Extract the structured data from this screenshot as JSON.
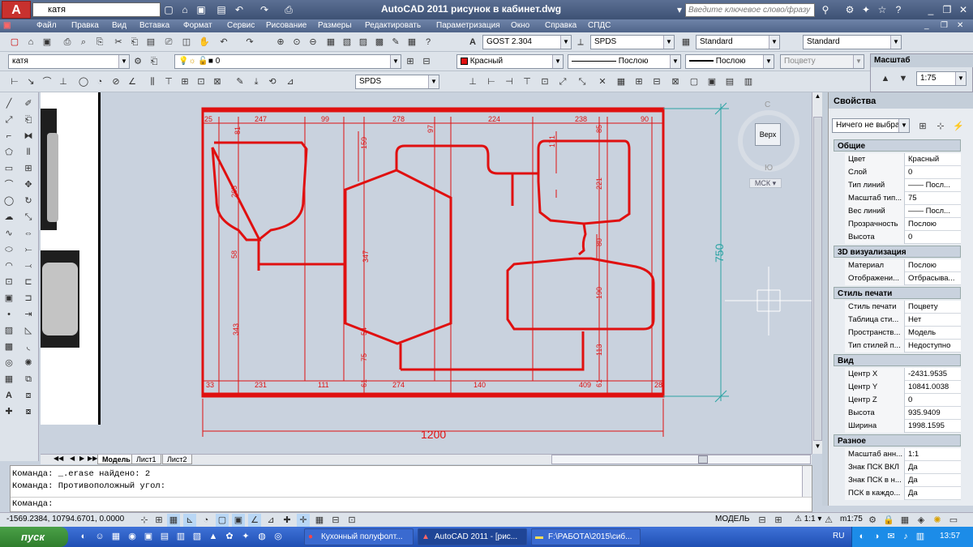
{
  "titlebar": {
    "logo": "A",
    "workspace": "катя",
    "title": "AutoCAD 2011    рисунок в кабинет.dwg",
    "search_placeholder": "Введите ключевое слово/фразу"
  },
  "menu": [
    "Файл",
    "Правка",
    "Вид",
    "Вставка",
    "Формат",
    "Сервис",
    "Рисование",
    "Размеры",
    "Редактировать",
    "Параметризация",
    "Окно",
    "Справка",
    "СПДС"
  ],
  "toolbar": {
    "text_style": "GOST 2.304",
    "dim_style": "SPDS",
    "table_style": "Standard",
    "mleader_style": "Standard",
    "layer_state": "катя",
    "layer": "0",
    "color": "Красный",
    "linetype": "Послою",
    "lineweight": "Послою",
    "plotstyle": "Поцвету",
    "dim_combo": "SPDS"
  },
  "scale_panel": {
    "title": "Масштаб",
    "value": "1:75"
  },
  "viewcube": {
    "north": "С",
    "south": "Ю",
    "face": "Верх",
    "ucs": "МСК"
  },
  "properties": {
    "title": "Свойства",
    "selection": "Ничего не выбра",
    "sections": [
      {
        "name": "Общие",
        "rows": [
          {
            "k": "Цвет",
            "v": "Красный"
          },
          {
            "k": "Слой",
            "v": "0"
          },
          {
            "k": "Тип линий",
            "v": "—— Посл..."
          },
          {
            "k": "Масштаб тип...",
            "v": "75"
          },
          {
            "k": "Вес линий",
            "v": "—— Посл..."
          },
          {
            "k": "Прозрачность",
            "v": "Послою"
          },
          {
            "k": "Высота",
            "v": "0"
          }
        ]
      },
      {
        "name": "3D визуализация",
        "rows": [
          {
            "k": "Материал",
            "v": "Послою"
          },
          {
            "k": "Отображени...",
            "v": "Отбрасыва..."
          }
        ]
      },
      {
        "name": "Стиль печати",
        "rows": [
          {
            "k": "Стиль печати",
            "v": "Поцвету"
          },
          {
            "k": "Таблица сти...",
            "v": "Нет"
          },
          {
            "k": "Пространств...",
            "v": "Модель"
          },
          {
            "k": "Тип стилей п...",
            "v": "Недоступно"
          }
        ]
      },
      {
        "name": "Вид",
        "rows": [
          {
            "k": "Центр X",
            "v": "-2431.9535"
          },
          {
            "k": "Центр Y",
            "v": "10841.0038"
          },
          {
            "k": "Центр Z",
            "v": "0"
          },
          {
            "k": "Высота",
            "v": "935.9409"
          },
          {
            "k": "Ширина",
            "v": "1998.1595"
          }
        ]
      },
      {
        "name": "Разное",
        "rows": [
          {
            "k": "Масштаб анн...",
            "v": "1:1"
          },
          {
            "k": "Знак ПСК ВКЛ",
            "v": "Да"
          },
          {
            "k": "Знак ПСК в н...",
            "v": "Да"
          },
          {
            "k": "ПСК в каждо...",
            "v": "Да"
          }
        ]
      }
    ]
  },
  "drawing": {
    "dims_top": [
      "25",
      "247",
      "99",
      "278",
      "224",
      "238",
      "90"
    ],
    "dims_bottom": [
      "33",
      "231",
      "111",
      "274",
      "140",
      "409",
      "28"
    ],
    "dims_vertical": [
      "81",
      "159",
      "97",
      "171",
      "265",
      "221",
      "58",
      "347",
      "80",
      "190",
      "343",
      "54",
      "75",
      "113",
      "61",
      "61",
      "85"
    ],
    "overall_width": "1200",
    "overall_height": "750"
  },
  "tabs": [
    "Модель",
    "Лист1",
    "Лист2"
  ],
  "command": {
    "lines": [
      "Команда: _.erase найдено: 2",
      "Команда: Противоположный угол:"
    ],
    "prompt": "Команда:"
  },
  "status": {
    "coords": "-1569.2384, 10794.6701, 0.0000",
    "mode": "МОДЕЛЬ",
    "annot_scale": "1:1",
    "scale": "m1:75"
  },
  "taskbar": {
    "start": "пуск",
    "windows": [
      "Кухонный полуфолт...",
      "AutoCAD 2011 - [рис...",
      "F:\\РАБОТА\\2015\\сиб..."
    ],
    "lang": "RU",
    "time": "13:57"
  },
  "colors": {
    "drawing_red": "#e01010",
    "dim_teal": "#2aa3a3",
    "canvas": "#c9d2de"
  }
}
